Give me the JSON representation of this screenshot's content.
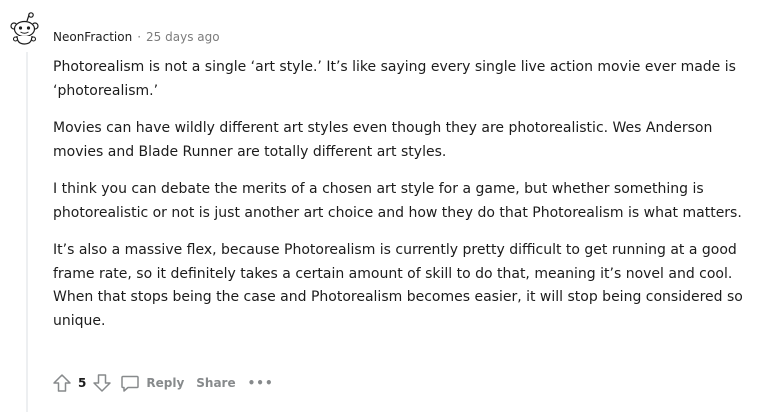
{
  "comment": {
    "username": "NeonFraction",
    "separator": "·",
    "timestamp": "25 days ago",
    "paragraphs": [
      "Photorealism is not a single ‘art style.’ It’s like saying every single live action movie ever made is ‘photorealism.’",
      "Movies can have wildly different art styles even though they are photorealistic. Wes Anderson movies and Blade Runner are totally different art styles.",
      "I think you can debate the merits of a chosen art style for a game, but whether something is photorealistic or not is just another art choice and how they do that Photorealism is what matters.",
      "It’s also a massive flex, because Photorealism is currently pretty difficult to get running at a good frame rate, so it definitely takes a certain amount of skill to do that, meaning it’s novel and cool. When that stops being the case and Photorealism becomes easier, it will stop being considered so unique."
    ]
  },
  "actions": {
    "score": "5",
    "reply_label": "Reply",
    "share_label": "Share",
    "more_label": "•••"
  },
  "icons": {
    "avatar": "snoo-avatar-icon",
    "upvote": "upvote-arrow-icon",
    "downvote": "downvote-arrow-icon",
    "reply": "comment-bubble-icon",
    "more": "more-dots-icon"
  },
  "colors": {
    "text": "#1c1c1c",
    "meta": "#7c7c7c",
    "action": "#878a8c",
    "thread_line": "#edeff1"
  }
}
